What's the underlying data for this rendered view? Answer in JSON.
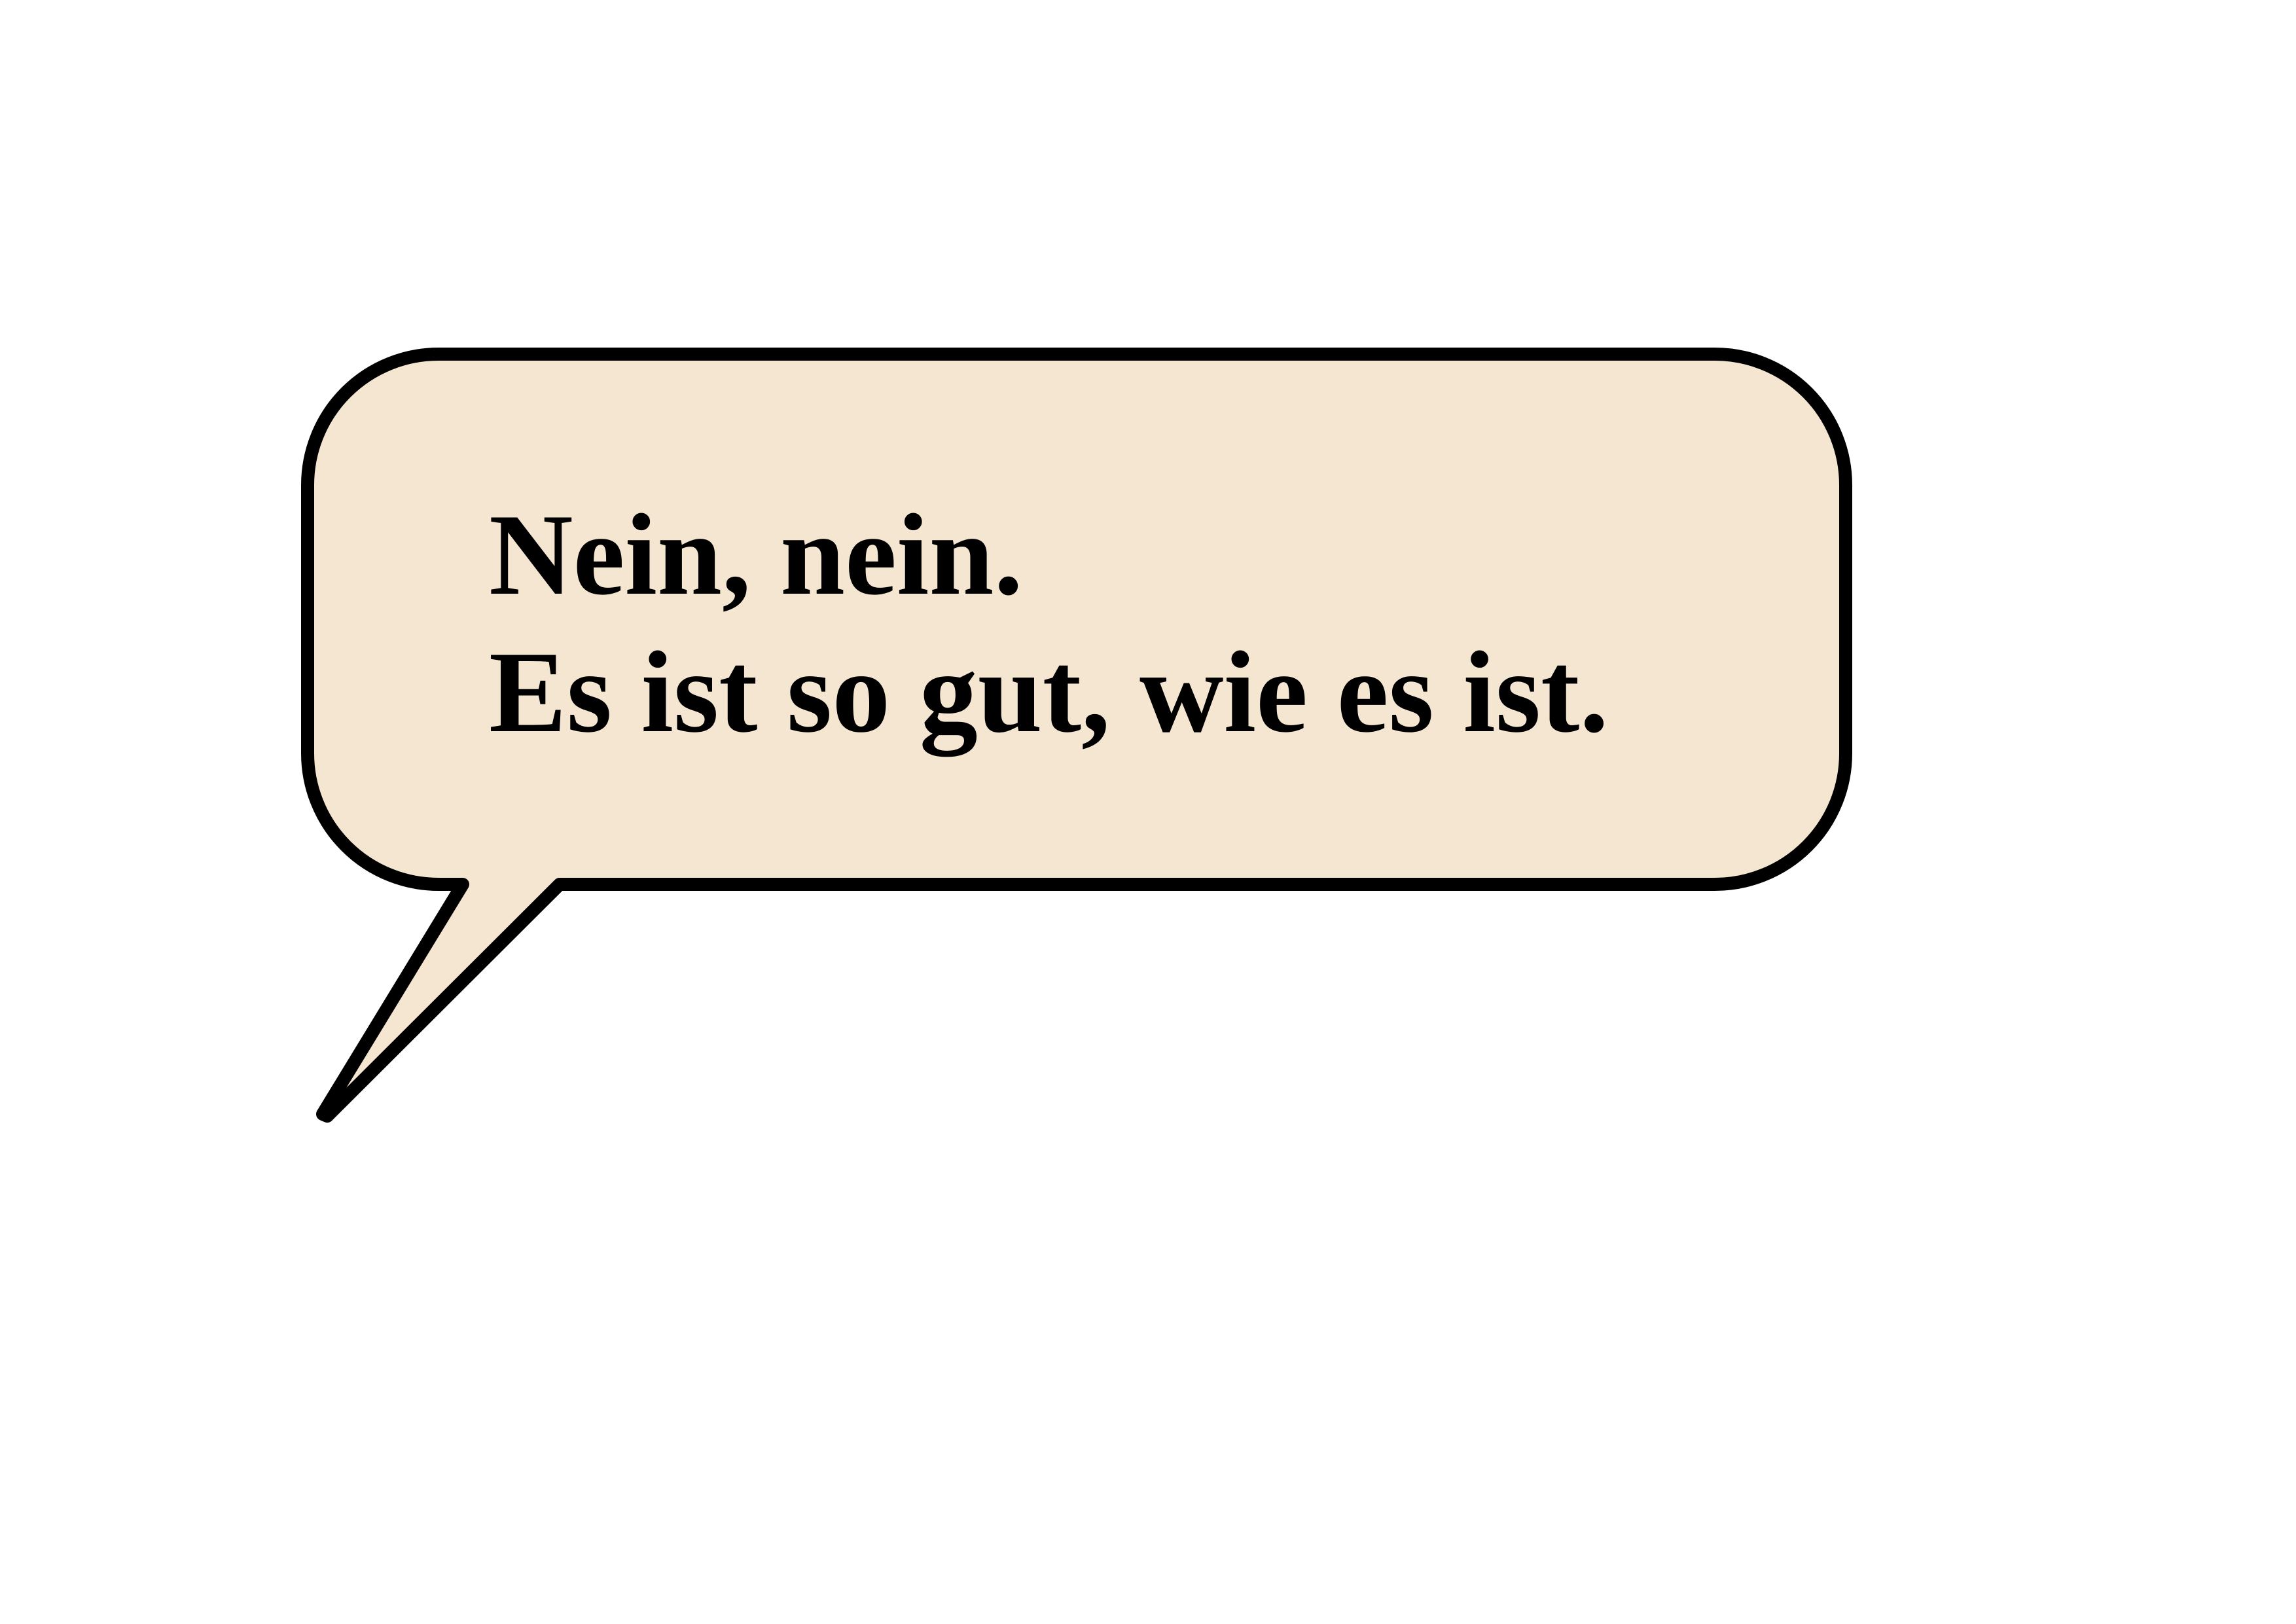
{
  "speech_bubble": {
    "lines": [
      "Nein, nein.",
      "Es ist so gut, wie es ist."
    ],
    "fill_color": "#f5e6d1",
    "outline_color": "#000000"
  }
}
